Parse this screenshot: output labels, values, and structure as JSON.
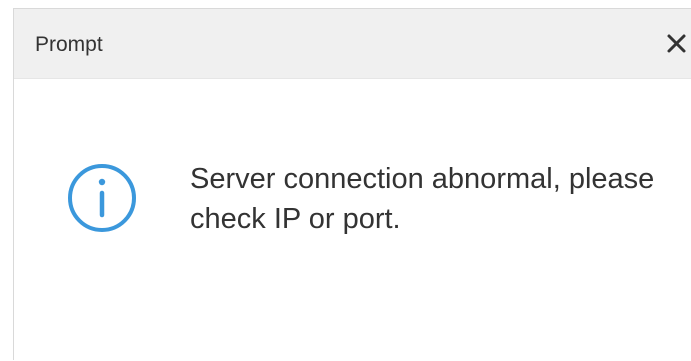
{
  "dialog": {
    "title": "Prompt",
    "close_icon": "close-icon",
    "info_icon": "info-circle-icon",
    "message": "Server connection abnormal, please check IP or port.",
    "accent_color": "#3b98dc"
  }
}
